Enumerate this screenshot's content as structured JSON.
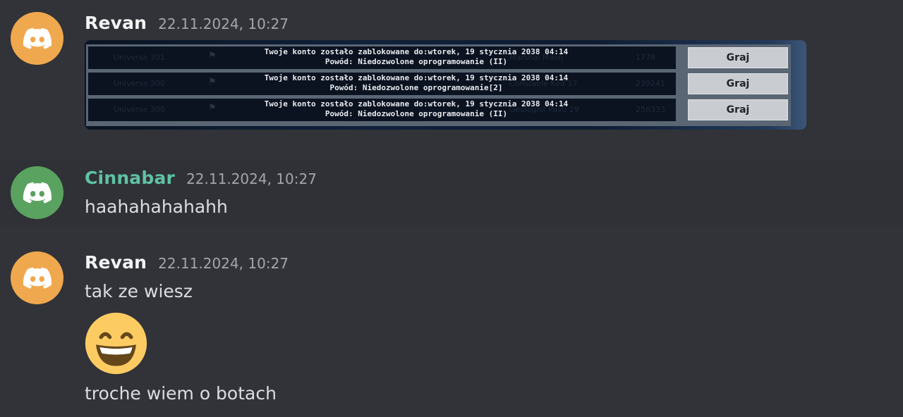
{
  "colors": {
    "background": "#313338",
    "revan_name": "#f2f3f5",
    "cinnabar_name": "#5fc2a3",
    "revan_avatar": "#f0a84f",
    "cinnabar_avatar": "#5aa25f"
  },
  "messages": [
    {
      "username": "Revan",
      "timestamp": "22.11.2024, 10:27",
      "avatar_icon": "discord-logo-icon",
      "embed_rows": [
        {
          "ban_line1": "Twoje konto zostało zablokowane do:wtorek, 19 stycznia 2038 04:14",
          "ban_line2": "Powód: Niedozwolone oprogramowanie (II)",
          "ghost_universe": "Universe 301",
          "ghost_name": "Marshal Malin",
          "ghost_score": "1778",
          "play_label": "Graj"
        },
        {
          "ban_line1": "Twoje konto zostało zablokowane do:wtorek, 19 stycznia 2038 04:14",
          "ban_line2": "Powód: Niedozwolone oprogramowanie[2]",
          "ghost_universe": "Universe 300",
          "ghost_name": "Constable Ked 17",
          "ghost_score": "239241",
          "play_label": "Graj"
        },
        {
          "ban_line1": "Twoje konto zostało zablokowane do:wtorek, 19 stycznia 2038 04:14",
          "ban_line2": "Powód: Niedozwolone oprogramowanie (II)",
          "ghost_universe": "Universe 300",
          "ghost_name": "Geologist Pavo 29",
          "ghost_score": "256333",
          "play_label": "Graj"
        }
      ]
    },
    {
      "username": "Cinnabar",
      "timestamp": "22.11.2024, 10:27",
      "avatar_icon": "discord-logo-icon",
      "text": "haahahahahahh"
    },
    {
      "username": "Revan",
      "timestamp": "22.11.2024, 10:27",
      "avatar_icon": "discord-logo-icon",
      "text": "tak ze wiesz",
      "emoji": "grinning-smile-emoji",
      "text2": "troche wiem o botach"
    }
  ]
}
